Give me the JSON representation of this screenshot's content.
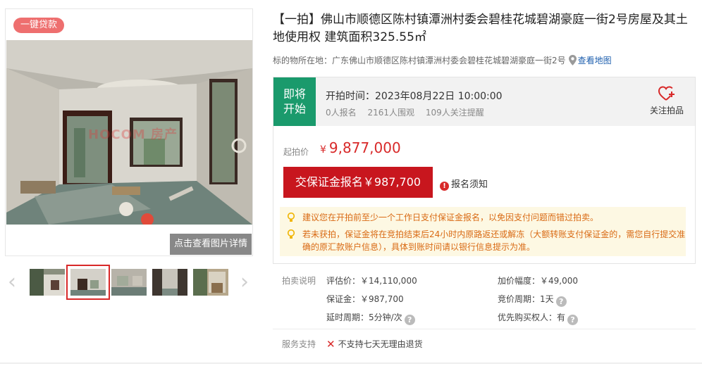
{
  "gallery": {
    "loan_tag": "一键贷款",
    "watermark": "HOCOM 房产",
    "photo_detail_button": "点击查看图片详情",
    "prev_arrow": "‹",
    "next_arrow": "›"
  },
  "listing": {
    "title": "【一拍】佛山市顺德区陈村镇潭洲村委会碧桂花城碧湖豪庭一街2号房屋及其土地使用权 建筑面积325.55㎡",
    "location_label": "标的物所在地：",
    "location": "广东佛山市顺德区陈村镇潭洲村委会碧桂花城碧湖豪庭一街2号",
    "map_link": "查看地图"
  },
  "auction": {
    "status_line1": "即将",
    "status_line2": "开始",
    "start_time": "开拍时间：2023年08月22日 10:00:00",
    "signups": "0人报名",
    "viewers": "2161人围观",
    "followers": "109人关注提醒",
    "follow_label": "关注拍品",
    "start_price_label": "起拍价",
    "currency": "¥",
    "start_price": "9,877,000",
    "deposit_button": "交保证金报名￥987,700",
    "notice_link": "报名须知",
    "tips": [
      "建议您在开拍前至少一个工作日支付保证金报名，以免因支付问题而错过拍卖。",
      "若未获拍，保证金将在竞拍结束后24小时内原路返还或解冻（大额转账支付保证金的，需您自行提交准确的原汇款账户信息），具体到账时间请以银行信息提示为准。"
    ]
  },
  "details": {
    "label": "拍卖说明",
    "appraisal": "评估价：￥14,110,000",
    "increment": "加价幅度：￥49,000",
    "deposit": "保证金：￥987,700",
    "bidding_period": "竞价周期：1天",
    "extension": "延时周期：5分钟/次",
    "priority_buyer": "优先购买权人：有"
  },
  "service": {
    "label": "服务支持",
    "value": "不支持七天无理由退货"
  },
  "colors": {
    "accent_red": "#d82929",
    "button_red": "#c8161e",
    "status_green": "#1a9a6c",
    "tip_orange": "#d96a14",
    "link_blue": "#1e5fae"
  }
}
